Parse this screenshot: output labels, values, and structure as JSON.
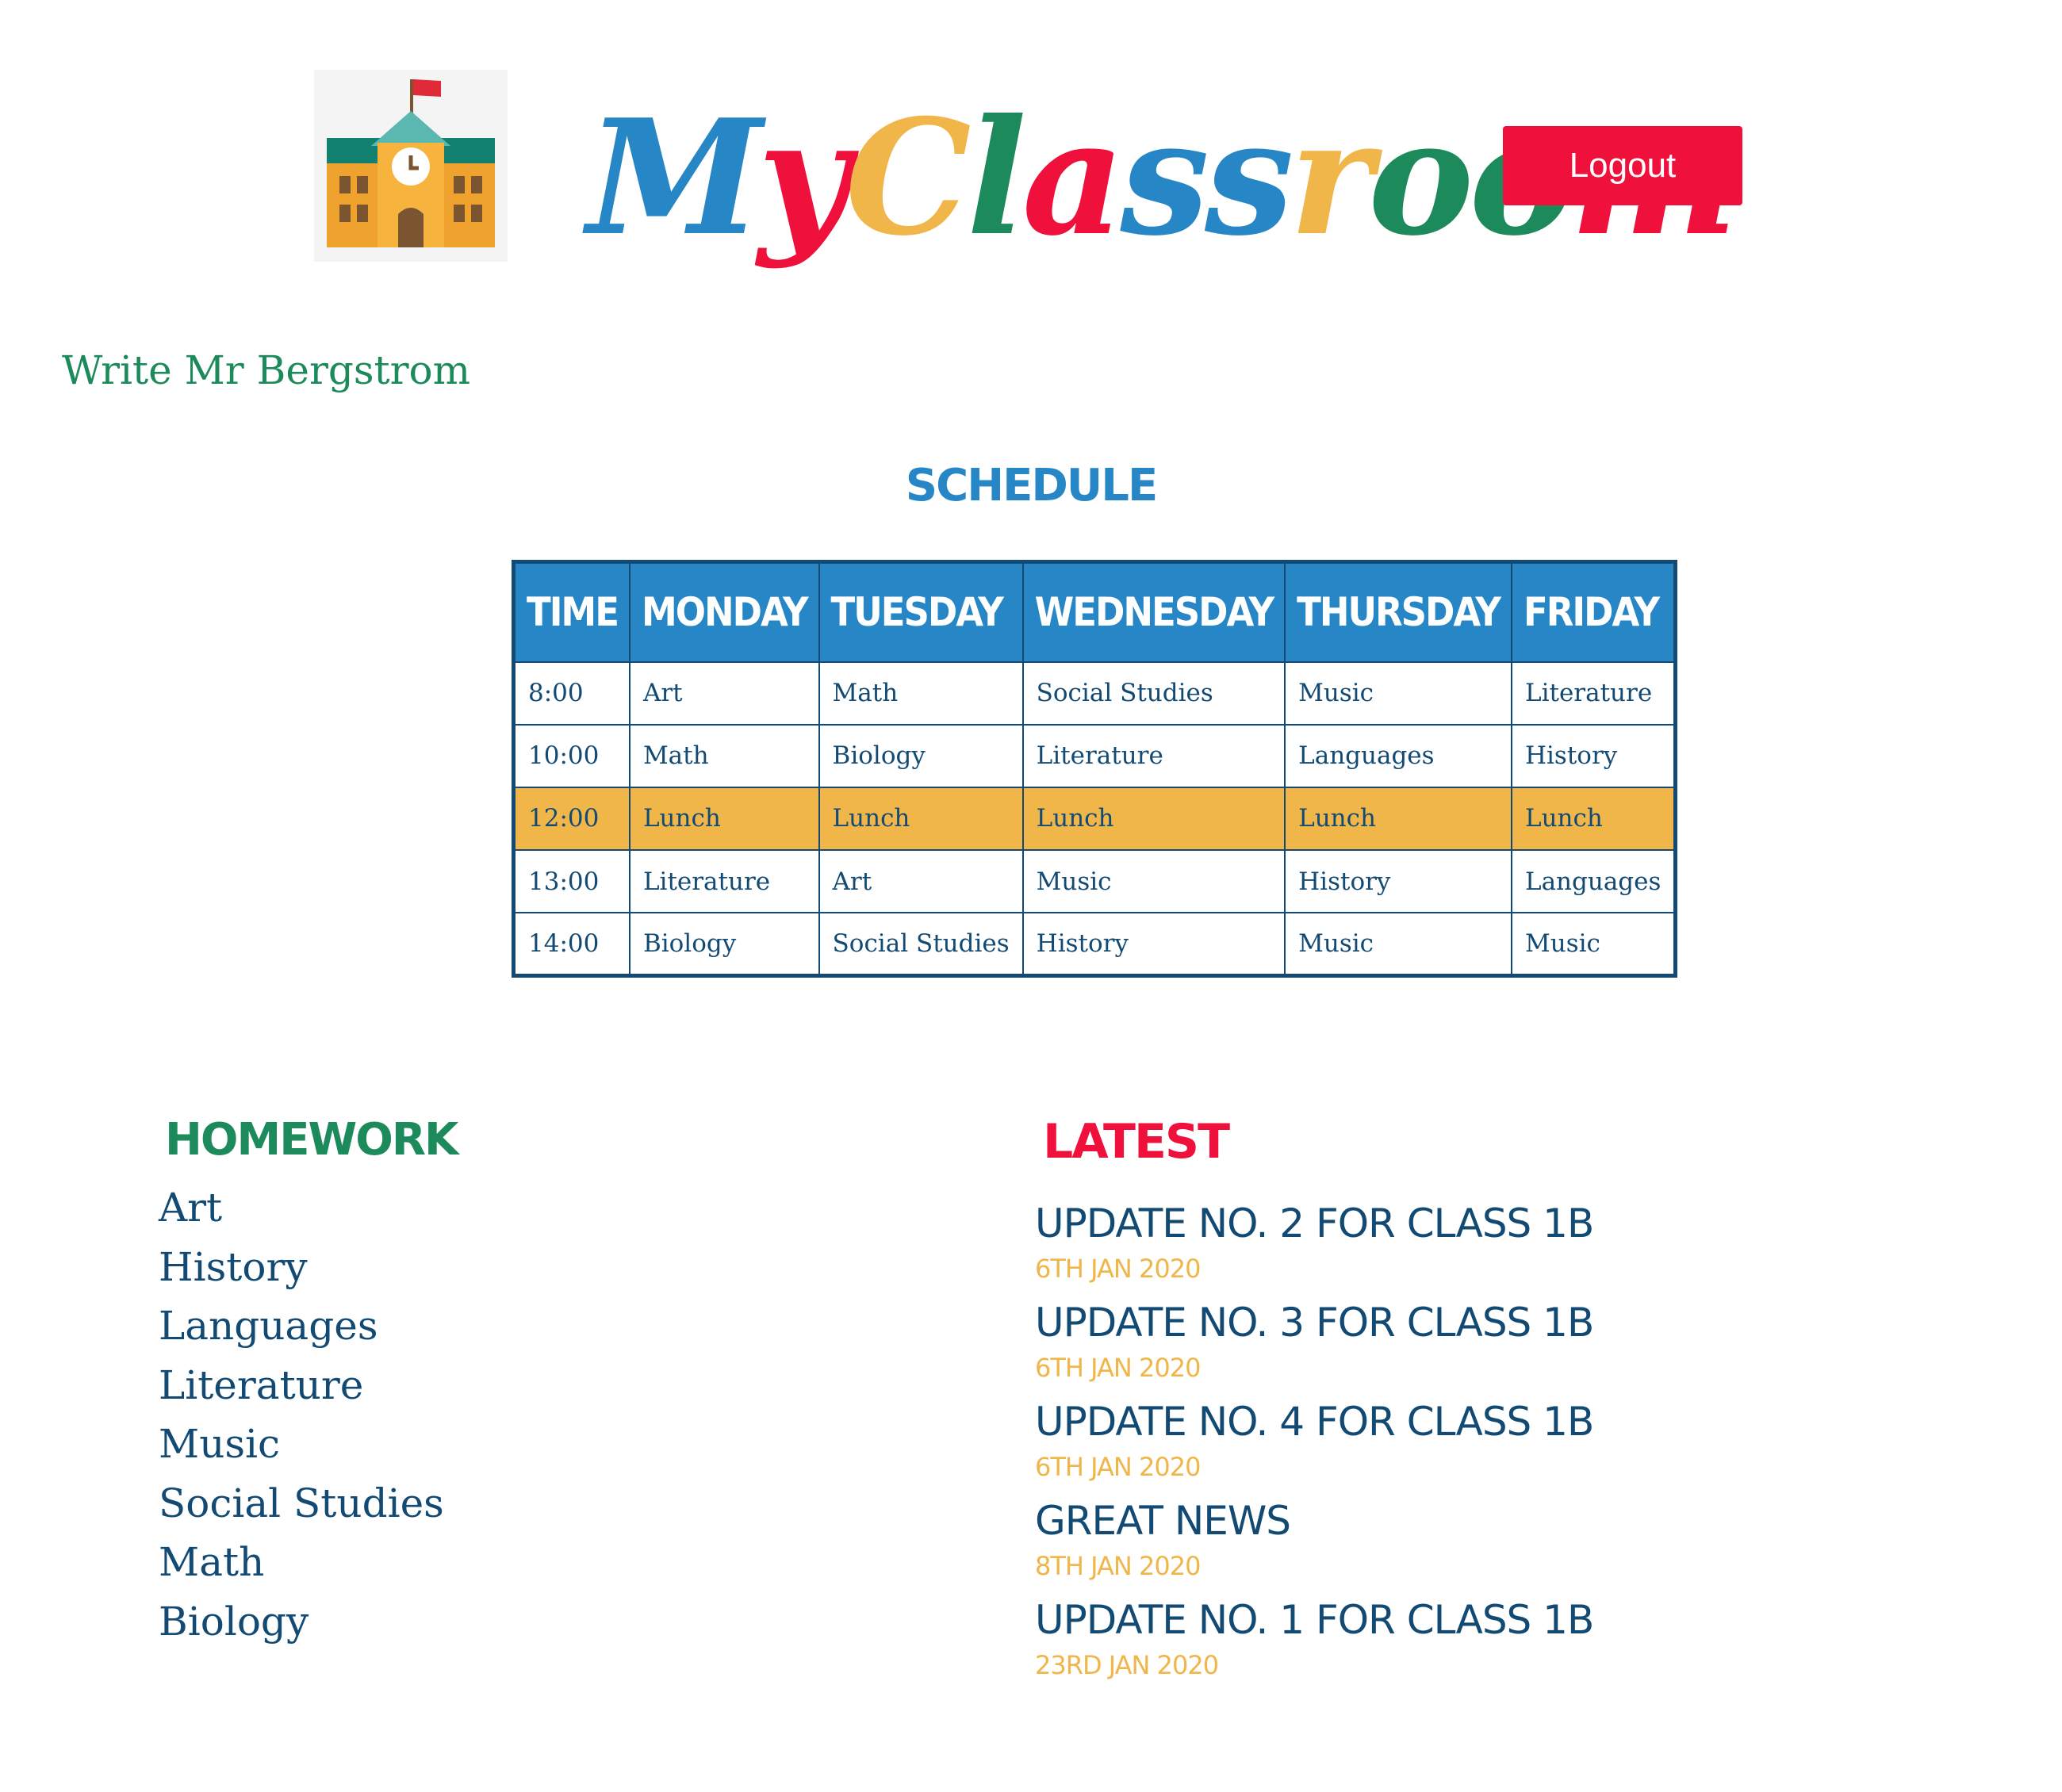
{
  "header": {
    "brand_letters": [
      {
        "ch": "M",
        "color": "#2786c5"
      },
      {
        "ch": "y",
        "color": "#f0103c"
      },
      {
        "ch": "C",
        "color": "#f0b64a"
      },
      {
        "ch": "l",
        "color": "#1d8a5b"
      },
      {
        "ch": "a",
        "color": "#f0103c"
      },
      {
        "ch": "s",
        "color": "#2786c5"
      },
      {
        "ch": "s",
        "color": "#2786c5"
      },
      {
        "ch": "r",
        "color": "#f0b64a"
      },
      {
        "ch": "o",
        "color": "#1d8a5b"
      },
      {
        "ch": "o",
        "color": "#1d8a5b"
      },
      {
        "ch": "m",
        "color": "#f0103c"
      }
    ],
    "logo_icon": "school-building-icon",
    "logout_label": "Logout"
  },
  "user": {
    "name": "Write Mr Bergstrom"
  },
  "schedule": {
    "title": "SCHEDULE",
    "headers": [
      "TIME",
      "MONDAY",
      "TUESDAY",
      "WEDNESDAY",
      "THURSDAY",
      "FRIDAY"
    ],
    "rows": [
      [
        "8:00",
        "Art",
        "Math",
        "Social Studies",
        "Music",
        "Literature"
      ],
      [
        "10:00",
        "Math",
        "Biology",
        "Literature",
        "Languages",
        "History"
      ],
      [
        "12:00",
        "Lunch",
        "Lunch",
        "Lunch",
        "Lunch",
        "Lunch"
      ],
      [
        "13:00",
        "Literature",
        "Art",
        "Music",
        "History",
        "Languages"
      ],
      [
        "14:00",
        "Biology",
        "Social Studies",
        "History",
        "Music",
        "Music"
      ]
    ]
  },
  "homework": {
    "title": "HOMEWORK",
    "items": [
      "Art",
      "History",
      "Languages",
      "Literature",
      "Music",
      "Social Studies",
      "Math",
      "Biology"
    ]
  },
  "latest": {
    "title": "LATEST",
    "items": [
      {
        "title": "UPDATE NO. 2 FOR CLASS 1B",
        "date": "6TH JAN 2020"
      },
      {
        "title": "UPDATE NO. 3 FOR CLASS 1B",
        "date": "6TH JAN 2020"
      },
      {
        "title": "UPDATE NO. 4 FOR CLASS 1B",
        "date": "6TH JAN 2020"
      },
      {
        "title": "GREAT NEWS",
        "date": "8TH JAN 2020"
      },
      {
        "title": "UPDATE NO. 1 FOR CLASS 1B",
        "date": "23RD JAN 2020"
      }
    ]
  },
  "colors": {
    "blue": "#2786c5",
    "navy": "#124a73",
    "green": "#1d8a5b",
    "red": "#f0103c",
    "yellow": "#f0b64a"
  }
}
